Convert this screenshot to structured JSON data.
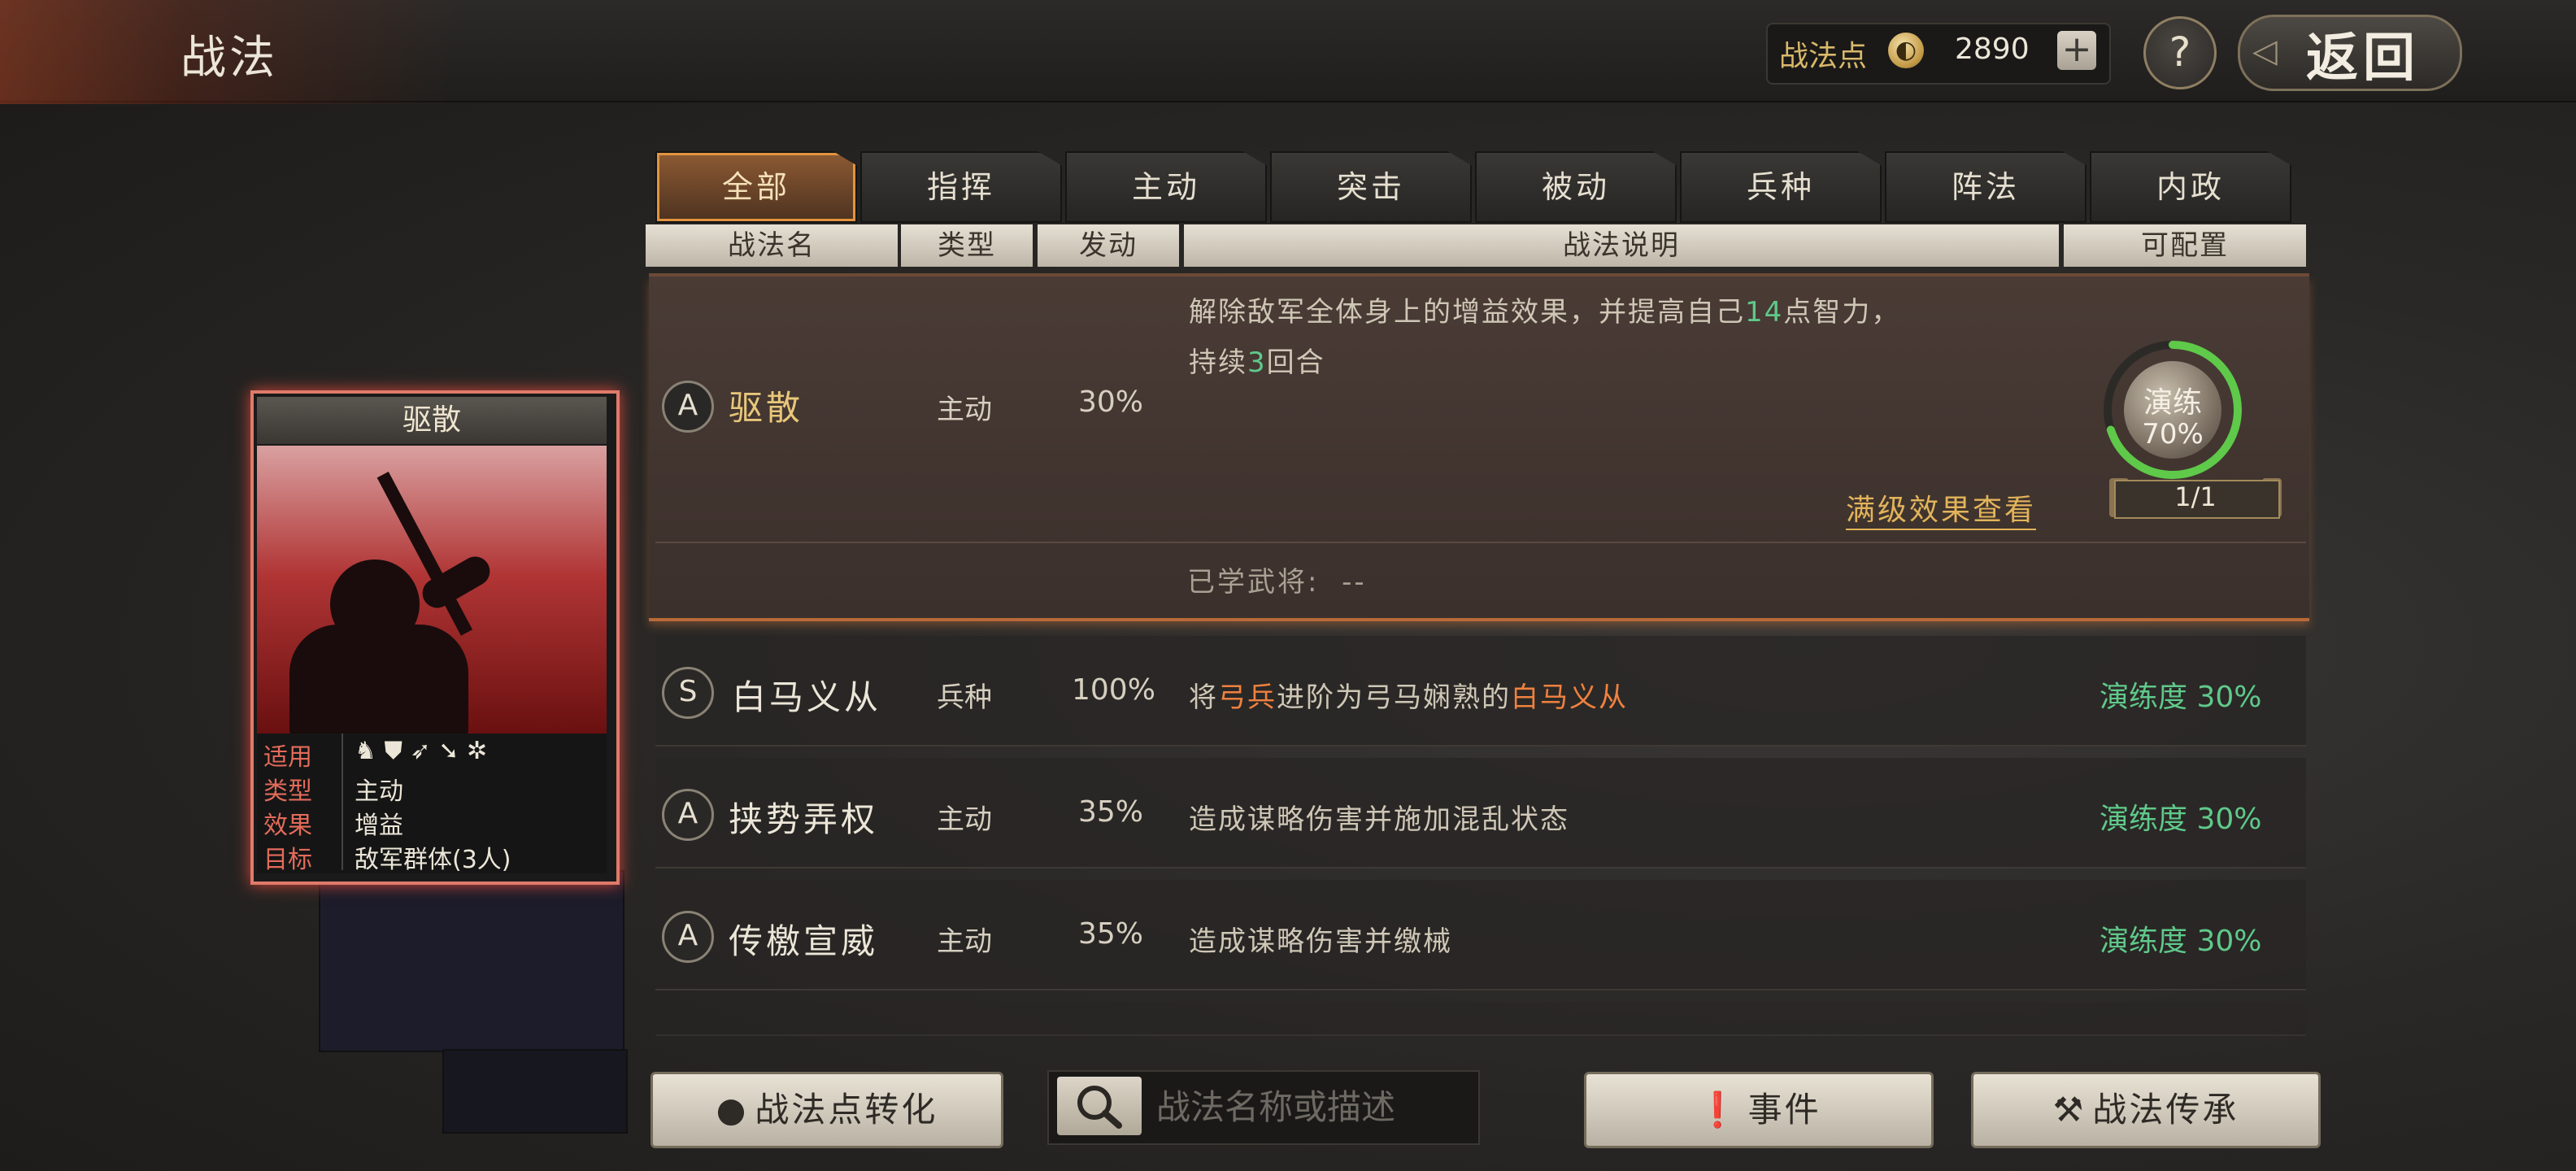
{
  "header": {
    "title": "战法",
    "points_label": "战法点",
    "points_value": "2890",
    "add_symbol": "+",
    "help_symbol": "?",
    "back_label": "返回"
  },
  "tabs": [
    {
      "label": "全部",
      "active": true
    },
    {
      "label": "指挥",
      "active": false
    },
    {
      "label": "主动",
      "active": false
    },
    {
      "label": "突击",
      "active": false
    },
    {
      "label": "被动",
      "active": false
    },
    {
      "label": "兵种",
      "active": false
    },
    {
      "label": "阵法",
      "active": false
    },
    {
      "label": "内政",
      "active": false
    }
  ],
  "columns": {
    "name": "战法名",
    "type": "类型",
    "trigger": "发动",
    "desc": "战法说明",
    "config": "可配置"
  },
  "selected": {
    "grade": "A",
    "name": "驱散",
    "type": "主动",
    "rate": "30%",
    "desc_part1": "解除敌军全体身上的增益效果，并提高自己",
    "desc_num1": "14",
    "desc_part2": "点智力，",
    "desc_line2_part1": "持续",
    "desc_num2": "3",
    "desc_line2_part2": "回合",
    "drill_label": "演练",
    "drill_pct": "70%",
    "drill_progress": 0.7,
    "drill_count": "1/1",
    "max_link": "满级效果查看",
    "learned_label": "已学武将:",
    "learned_value": "--"
  },
  "rows": [
    {
      "grade": "S",
      "name": "白马义从",
      "type": "兵种",
      "rate": "100%",
      "desc_a": "将",
      "desc_hl1": "弓兵",
      "desc_b": "进阶为弓马娴熟的",
      "desc_hl2": "白马义从",
      "proficiency": "演练度 30%"
    },
    {
      "grade": "A",
      "name": "挟势弄权",
      "type": "主动",
      "rate": "35%",
      "desc": "造成谋略伤害并施加混乱状态",
      "proficiency": "演练度 30%"
    },
    {
      "grade": "A",
      "name": "传檄宣威",
      "type": "主动",
      "rate": "35%",
      "desc": "造成谋略伤害并缴械",
      "proficiency": "演练度 30%"
    }
  ],
  "card": {
    "name": "驱散",
    "rows": [
      {
        "key": "适用",
        "value": ""
      },
      {
        "key": "类型",
        "value": "主动"
      },
      {
        "key": "效果",
        "value": "增益"
      },
      {
        "key": "目标",
        "value": "敌军群体(3人)"
      }
    ]
  },
  "bottom": {
    "convert_label": "战法点转化",
    "search_placeholder": "战法名称或描述",
    "event_label": "事件",
    "inherit_label": "战法传承"
  },
  "colors": {
    "accent_orange": "#f0813f",
    "proficiency_green": "#5fc98a",
    "gold": "#e2b45a"
  }
}
